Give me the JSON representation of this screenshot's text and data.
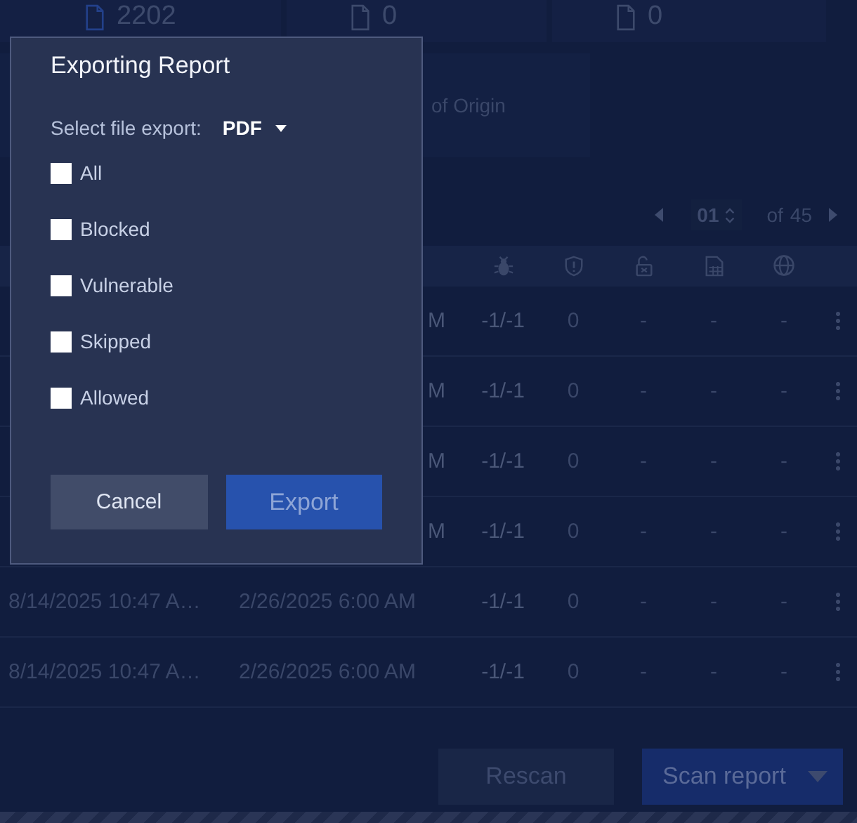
{
  "stats": [
    {
      "value": "2202"
    },
    {
      "value": "0"
    },
    {
      "value": "0"
    }
  ],
  "info_text": "of Origin",
  "pagination": {
    "page": "01",
    "of": "of",
    "total": "45"
  },
  "table": {
    "rows": [
      {
        "column_2": "M",
        "column_3": "-1/-1",
        "column_4": "0",
        "column_5": "-",
        "column_6": "-",
        "column_7": "-"
      },
      {
        "column_2": "M",
        "column_3": "-1/-1",
        "column_4": "0",
        "column_5": "-",
        "column_6": "-",
        "column_7": "-"
      },
      {
        "column_2": "M",
        "column_3": "-1/-1",
        "column_4": "0",
        "column_5": "-",
        "column_6": "-",
        "column_7": "-"
      },
      {
        "column_2": "M",
        "column_3": "-1/-1",
        "column_4": "0",
        "column_5": "-",
        "column_6": "-",
        "column_7": "-"
      },
      {
        "column_1": "8/14/2025 10:47 A…",
        "column_2": "2/26/2025 6:00 AM",
        "column_3": "-1/-1",
        "column_4": "0",
        "column_5": "-",
        "column_6": "-",
        "column_7": "-"
      },
      {
        "column_1": "8/14/2025 10:47 A…",
        "column_2": "2/26/2025 6:00 AM",
        "column_3": "-1/-1",
        "column_4": "0",
        "column_5": "-",
        "column_6": "-",
        "column_7": "-"
      }
    ]
  },
  "actions": [
    {
      "label": "Rescan",
      "kind": "plain"
    },
    {
      "label": "Scan report",
      "kind": "dropdown"
    }
  ],
  "dialog": {
    "title": "Exporting Report",
    "format_label": "Select file export:",
    "format": "PDF",
    "options": [
      {
        "label": "All",
        "checked": false
      },
      {
        "label": "Blocked",
        "checked": false
      },
      {
        "label": "Vulnerable",
        "checked": false
      },
      {
        "label": "Skipped",
        "checked": false
      },
      {
        "label": "Allowed",
        "checked": false
      }
    ],
    "buttons": [
      {
        "label": "Cancel",
        "kind": "secondary",
        "disabled": false
      },
      {
        "label": "Export",
        "kind": "primary",
        "disabled": true
      }
    ]
  }
}
